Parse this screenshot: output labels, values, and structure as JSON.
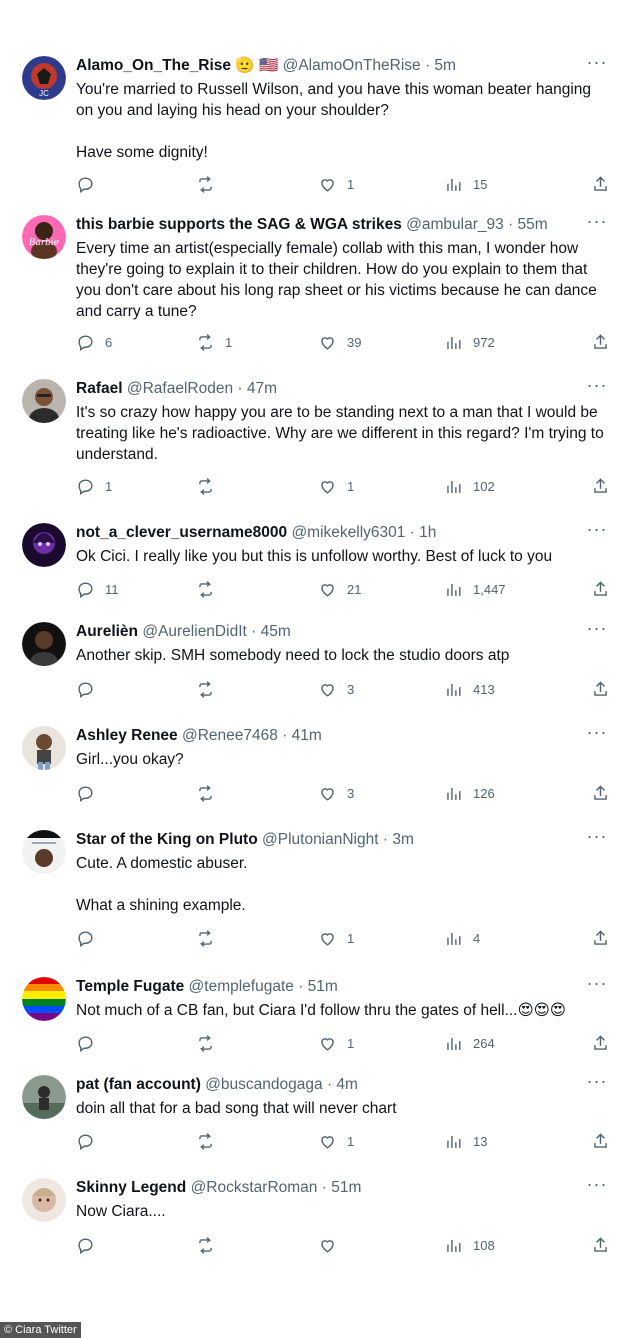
{
  "tweets": [
    {
      "name": "Alamo_On_The_Rise",
      "badges": "🫡 🇺🇸",
      "handle": "@AlamoOnTheRise",
      "time": "· 5m",
      "text": "You're married to Russell Wilson, and you have this woman beater hanging on you and laying his head on your shoulder?\n\nHave some dignity!",
      "replies": "",
      "retweets": "",
      "likes": "1",
      "views": "15"
    },
    {
      "name": "this barbie supports the SAG & WGA strikes",
      "badges": "",
      "handle": "@ambular_93",
      "time": "· 55m",
      "text": "Every time an artist(especially female) collab with this man, I wonder how they're going to explain it to their children. How do you explain to them that you don't care about his long rap sheet or his victims because he can dance and carry a tune?",
      "replies": "6",
      "retweets": "1",
      "likes": "39",
      "views": "972"
    },
    {
      "name": "Rafael",
      "badges": "",
      "handle": "@RafaelRoden",
      "time": "· 47m",
      "text": "It's so crazy how happy you are to be standing next to a man that I would be treating like he's radioactive. Why are we different in this regard? I'm trying to understand.",
      "replies": "1",
      "retweets": "",
      "likes": "1",
      "views": "102"
    },
    {
      "name": "not_a_clever_username8000",
      "badges": "",
      "handle": "@mikekelly6301",
      "time": "· 1h",
      "text": "Ok Cici. I really like you but this is unfollow worthy. Best of luck to you",
      "replies": "11",
      "retweets": "",
      "likes": "21",
      "views": "1,447"
    },
    {
      "name": "Aurelièn",
      "badges": "",
      "handle": "@AurelienDidIt",
      "time": "· 45m",
      "text": "Another skip. SMH somebody need to lock the studio doors atp",
      "replies": "",
      "retweets": "",
      "likes": "3",
      "views": "413"
    },
    {
      "name": "Ashley Renee",
      "badges": "",
      "handle": "@Renee7468",
      "time": "· 41m",
      "text": "Girl...you okay?",
      "replies": "",
      "retweets": "",
      "likes": "3",
      "views": "126"
    },
    {
      "name": "Star of the King on Pluto",
      "badges": "",
      "handle": "@PlutonianNight",
      "time": "· 3m",
      "text": "Cute. A domestic abuser.\n\nWhat a shining example.",
      "replies": "",
      "retweets": "",
      "likes": "1",
      "views": "4"
    },
    {
      "name": "Temple Fugate",
      "badges": "",
      "handle": "@templefugate",
      "time": "· 51m",
      "text": "Not much of a CB fan, but Ciara I'd follow thru the gates of hell...😍😍😍",
      "replies": "",
      "retweets": "",
      "likes": "1",
      "views": "264"
    },
    {
      "name": "pat (fan account)",
      "badges": "",
      "handle": "@buscandogaga",
      "time": "· 4m",
      "text": "doin all that for a bad song that will never chart",
      "replies": "",
      "retweets": "",
      "likes": "1",
      "views": "13"
    },
    {
      "name": "Skinny Legend",
      "badges": "",
      "handle": "@RockstarRoman",
      "time": "· 51m",
      "text": "Now Ciara....",
      "replies": "",
      "retweets": "",
      "likes": "",
      "views": "108"
    }
  ],
  "footer": {
    "credit": "© Ciara Twitter"
  },
  "icons": {
    "reply": "reply-icon",
    "retweet": "retweet-icon",
    "like": "heart-icon",
    "views": "views-icon",
    "share": "share-icon",
    "more": "more-icon"
  },
  "colors": {
    "text": "#0f1419",
    "muted": "#536471"
  }
}
